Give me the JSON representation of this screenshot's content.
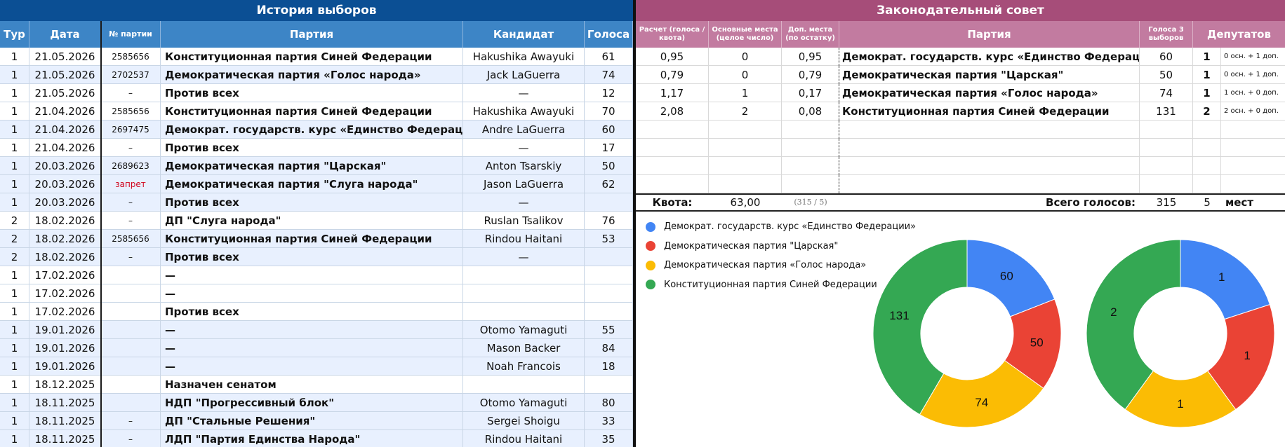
{
  "left": {
    "title": "История выборов",
    "headers": {
      "tur": "Тур",
      "date": "Дата",
      "num": "№ партии",
      "party": "Партия",
      "candidate": "Кандидат",
      "votes": "Голоса"
    },
    "rows": [
      {
        "tur": "1",
        "date": "21.05.2026",
        "num": "2585656",
        "party": "Конституционная партия Синей Федерации",
        "candidate": "Hakushika Awayuki",
        "votes": "61"
      },
      {
        "tur": "1",
        "date": "21.05.2026",
        "num": "2702537",
        "party": "Демократическая партия «Голос народа»",
        "candidate": "Jack LaGuerra",
        "votes": "74"
      },
      {
        "tur": "1",
        "date": "21.05.2026",
        "num": "–",
        "party": "Против всех",
        "candidate": "—",
        "votes": "12"
      },
      {
        "tur": "1",
        "date": "21.04.2026",
        "num": "2585656",
        "party": "Конституционная партия Синей Федерации",
        "candidate": "Hakushika Awayuki",
        "votes": "70"
      },
      {
        "tur": "1",
        "date": "21.04.2026",
        "num": "2697475",
        "party": "Демократ. государств. курс «Единство Федерации»",
        "candidate": "Andre LaGuerra",
        "votes": "60"
      },
      {
        "tur": "1",
        "date": "21.04.2026",
        "num": "–",
        "party": "Против всех",
        "candidate": "—",
        "votes": "17"
      },
      {
        "tur": "1",
        "date": "20.03.2026",
        "num": "2689623",
        "party": "Демократическая партия \"Царская\"",
        "candidate": "Anton Tsarskiy",
        "votes": "50"
      },
      {
        "tur": "1",
        "date": "20.03.2026",
        "num": "запрет",
        "party": "Демократическая партия \"Слуга народа\"",
        "candidate": "Jason LaGuerra",
        "votes": "62"
      },
      {
        "tur": "1",
        "date": "20.03.2026",
        "num": "–",
        "party": "Против всех",
        "candidate": "—",
        "votes": ""
      },
      {
        "tur": "2",
        "date": "18.02.2026",
        "num": "–",
        "party": "ДП \"Слуга народа\"",
        "candidate": "Ruslan Tsalikov",
        "votes": "76"
      },
      {
        "tur": "2",
        "date": "18.02.2026",
        "num": "2585656",
        "party": "Конституционная партия Синей Федерации",
        "candidate": "Rindou Haitani",
        "votes": "53"
      },
      {
        "tur": "2",
        "date": "18.02.2026",
        "num": "–",
        "party": "Против всех",
        "candidate": "—",
        "votes": ""
      },
      {
        "tur": "1",
        "date": "17.02.2026",
        "num": "",
        "party": "—",
        "candidate": "",
        "votes": ""
      },
      {
        "tur": "1",
        "date": "17.02.2026",
        "num": "",
        "party": "—",
        "candidate": "",
        "votes": ""
      },
      {
        "tur": "1",
        "date": "17.02.2026",
        "num": "",
        "party": "Против всех",
        "candidate": "",
        "votes": ""
      },
      {
        "tur": "1",
        "date": "19.01.2026",
        "num": "",
        "party": "—",
        "candidate": "Otomo Yamaguti",
        "votes": "55"
      },
      {
        "tur": "1",
        "date": "19.01.2026",
        "num": "",
        "party": "—",
        "candidate": "Mason Backer",
        "votes": "84"
      },
      {
        "tur": "1",
        "date": "19.01.2026",
        "num": "",
        "party": "—",
        "candidate": "Noah Francois",
        "votes": "18"
      },
      {
        "tur": "1",
        "date": "18.12.2025",
        "num": "",
        "party": "Назначен сенатом",
        "candidate": "",
        "votes": ""
      },
      {
        "tur": "1",
        "date": "18.11.2025",
        "num": "",
        "party": "НДП \"Прогрессивный блок\"",
        "candidate": "Otomo Yamaguti",
        "votes": "80"
      },
      {
        "tur": "1",
        "date": "18.11.2025",
        "num": "–",
        "party": "ДП \"Стальные Решения\"",
        "candidate": "Sergei Shoigu",
        "votes": "33"
      },
      {
        "tur": "1",
        "date": "18.11.2025",
        "num": "–",
        "party": "ЛДП \"Партия Единства Народа\"",
        "candidate": "Rindou Haitani",
        "votes": "35"
      }
    ]
  },
  "right": {
    "title": "Законодательный совет",
    "headers": {
      "calc": "Расчет (голоса / квота)",
      "main": "Основные места (целое число)",
      "add": "Доп. места (по остатку)",
      "party": "Партия",
      "v3": "Голоса 3 выборов",
      "dep": "Депутатов"
    },
    "rows": [
      {
        "calc": "0,95",
        "main": "0",
        "add": "0,95",
        "party": "Демократ. государств. курс «Единство Федерации»",
        "v3": "60",
        "dep": "1",
        "note": "0 осн. + 1 доп."
      },
      {
        "calc": "0,79",
        "main": "0",
        "add": "0,79",
        "party": "Демократическая партия \"Царская\"",
        "v3": "50",
        "dep": "1",
        "note": "0 осн. + 1 доп."
      },
      {
        "calc": "1,17",
        "main": "1",
        "add": "0,17",
        "party": "Демократическая партия «Голос народа»",
        "v3": "74",
        "dep": "1",
        "note": "1 осн. + 0 доп."
      },
      {
        "calc": "2,08",
        "main": "2",
        "add": "0,08",
        "party": "Конституционная партия Синей Федерации",
        "v3": "131",
        "dep": "2",
        "note": "2 осн. + 0 доп."
      },
      {
        "calc": "",
        "main": "",
        "add": "",
        "party": "",
        "v3": "",
        "dep": "",
        "note": ""
      },
      {
        "calc": "",
        "main": "",
        "add": "",
        "party": "",
        "v3": "",
        "dep": "",
        "note": ""
      },
      {
        "calc": "",
        "main": "",
        "add": "",
        "party": "",
        "v3": "",
        "dep": "",
        "note": ""
      },
      {
        "calc": "",
        "main": "",
        "add": "",
        "party": "",
        "v3": "",
        "dep": "",
        "note": ""
      }
    ],
    "quota": {
      "label": "Квота:",
      "value": "63,00",
      "formula": "(315 / 5)",
      "total_label": "Всего голосов:",
      "total_votes": "315",
      "seats": "5",
      "seats_label": "мест"
    }
  },
  "chart_data": [
    {
      "type": "pie",
      "categories": [
        "Демократ. государств. курс «Единство Федерации»",
        "Демократическая партия \"Царская\"",
        "Демократическая партия «Голос народа»",
        "Конституционная партия Синей Федерации"
      ],
      "values": [
        60,
        50,
        74,
        131
      ],
      "colors": [
        "#4285f4",
        "#ea4335",
        "#fbbc04",
        "#34a853"
      ],
      "legend": "top-left"
    },
    {
      "type": "pie",
      "categories": [
        "Демократ. государств. курс «Единство Федерации»",
        "Демократическая партия \"Царская\"",
        "Демократическая партия «Голос народа»",
        "Конституционная партия Синей Федерации"
      ],
      "values": [
        1,
        1,
        1,
        2
      ],
      "colors": [
        "#4285f4",
        "#ea4335",
        "#fbbc04",
        "#34a853"
      ]
    }
  ]
}
